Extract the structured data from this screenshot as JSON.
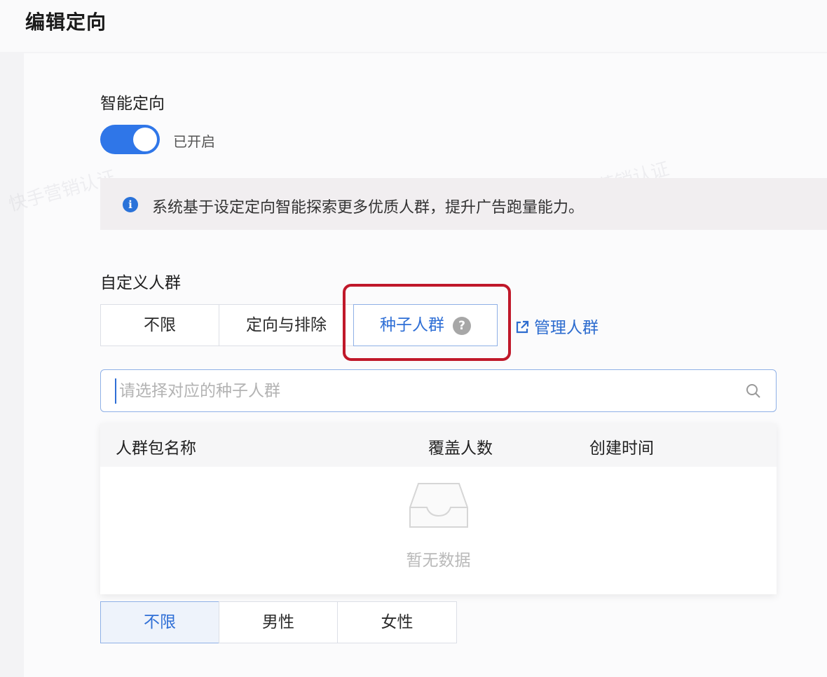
{
  "header": {
    "title": "编辑定向"
  },
  "smart_targeting": {
    "label": "智能定向",
    "toggle_on": true,
    "toggle_text": "已开启",
    "notice": "系统基于设定定向智能探索更多优质人群，提升广告跑量能力。"
  },
  "custom_audience": {
    "label": "自定义人群",
    "options": [
      "不限",
      "定向与排除",
      "种子人群"
    ],
    "selected": "种子人群",
    "help_symbol": "?",
    "manage_link": "管理人群",
    "search_placeholder": "请选择对应的种子人群",
    "table": {
      "columns": [
        "人群包名称",
        "覆盖人数",
        "创建时间"
      ],
      "empty_text": "暂无数据"
    }
  },
  "gender": {
    "options": [
      "不限",
      "男性",
      "女性"
    ],
    "selected": "不限"
  },
  "watermark_text": "快手营销认证",
  "colors": {
    "accent": "#2f76e8",
    "link": "#2d6ccf",
    "highlight": "#c0182a"
  }
}
